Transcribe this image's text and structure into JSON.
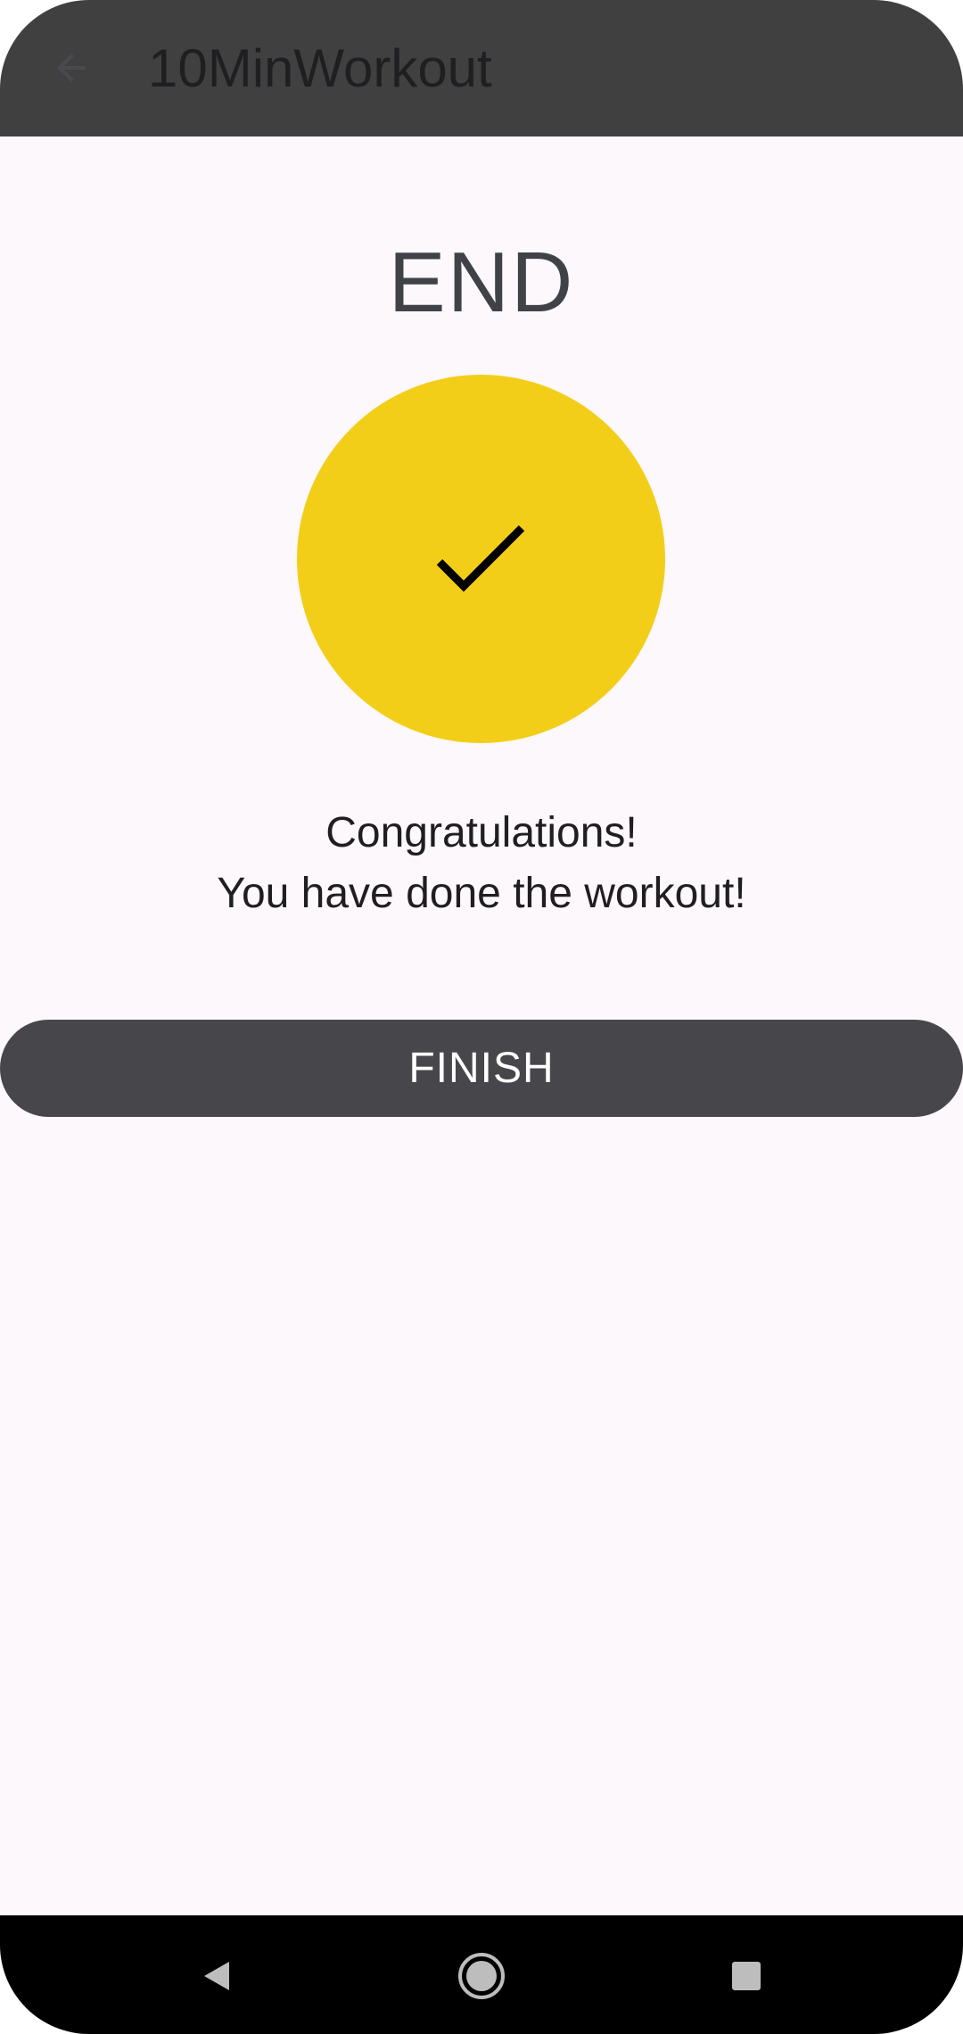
{
  "app_bar": {
    "title": "10MinWorkout",
    "back_icon": "arrow-back-icon"
  },
  "main": {
    "heading": "END",
    "status_icon": "checkmark-icon",
    "message_line1": "Congratulations!",
    "message_line2": "You have done the workout!",
    "finish_label": "FINISH"
  },
  "nav_bar": {
    "back_icon": "nav-back-icon",
    "home_icon": "nav-home-icon",
    "recents_icon": "nav-recents-icon"
  },
  "colors": {
    "app_bar_bg": "#414041",
    "page_bg": "#fdf8fb",
    "accent_circle": "#f3ce18",
    "button_bg": "#47474b",
    "button_text": "#ffffff"
  }
}
